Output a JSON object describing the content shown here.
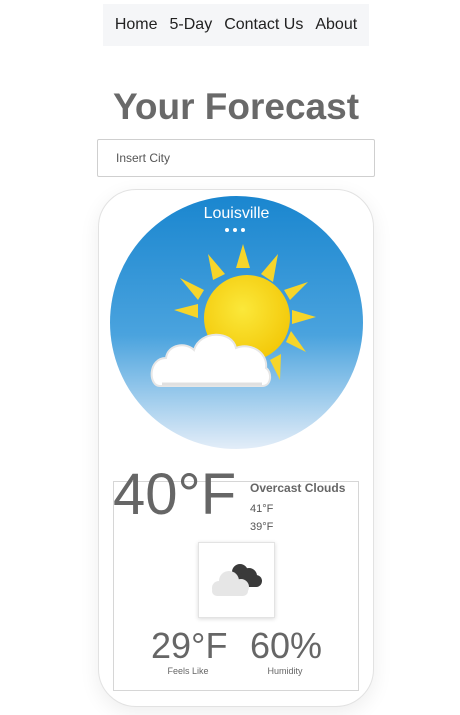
{
  "nav": {
    "items": [
      {
        "label": "Home"
      },
      {
        "label": "5-Day"
      },
      {
        "label": "Contact Us"
      },
      {
        "label": "About"
      }
    ]
  },
  "page": {
    "title": "Your Forecast"
  },
  "search": {
    "placeholder": "Insert City"
  },
  "weather": {
    "city": "Louisville",
    "temperature": "40°F",
    "description": "Overcast Clouds",
    "high": "41°F",
    "low": "39°F",
    "icon": "overcast-clouds-icon",
    "feels_like": {
      "value": "29°F",
      "label": "Feels Like"
    },
    "humidity": {
      "value": "60%",
      "label": "Humidity"
    }
  },
  "colors": {
    "sky_top": "#1e88d0",
    "sky_bottom": "#dfeaf6",
    "sun": "#f5d40a",
    "text_gray": "#666666"
  }
}
